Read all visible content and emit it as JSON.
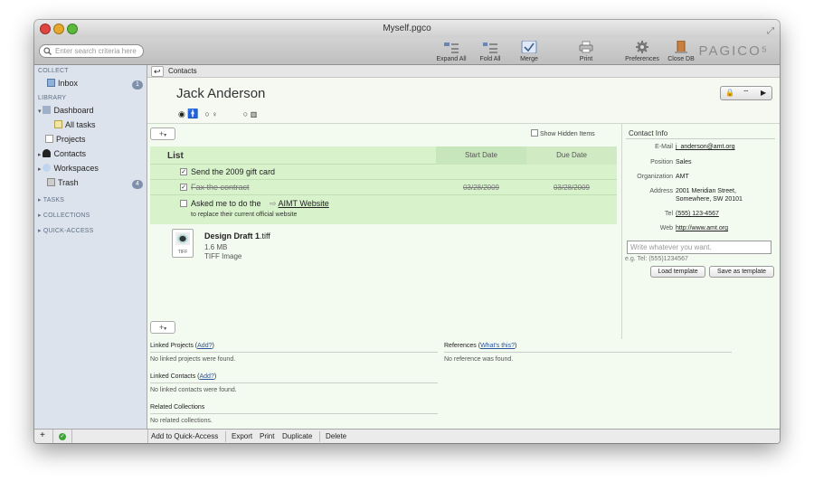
{
  "window": {
    "title": "Myself.pgco"
  },
  "toolbar": {
    "search_placeholder": "Enter search criteria here",
    "expand_all": "Expand All",
    "fold_all": "Fold All",
    "merge": "Merge",
    "print": "Print",
    "preferences": "Preferences",
    "close_db": "Close DB",
    "brand": "PAGICO⁵"
  },
  "sidebar": {
    "collect": "COLLECT",
    "inbox": "Inbox",
    "inbox_count": "1",
    "library": "LIBRARY",
    "dashboard": "Dashboard",
    "all_tasks": "All tasks",
    "projects": "Projects",
    "contacts": "Contacts",
    "workspaces": "Workspaces",
    "trash": "Trash",
    "trash_count": "4",
    "tasks": "TASKS",
    "collections": "COLLECTIONS",
    "quick_access": "QUICK-ACCESS"
  },
  "breadcrumb": {
    "current": "Contacts"
  },
  "contact": {
    "name": "Jack Anderson"
  },
  "list": {
    "show_hidden": "Show Hidden Items",
    "title": "List",
    "col_start": "Start Date",
    "col_due": "Due Date",
    "items": [
      {
        "text": "Send the 2009 gift card",
        "start": "",
        "due": ""
      },
      {
        "text": "Fax the contract",
        "start": "03/28/2009",
        "due": "03/28/2009"
      },
      {
        "text": "Asked me to do the",
        "link": "AIMT Website",
        "note": "to replace their current official website",
        "start": "",
        "due": ""
      }
    ]
  },
  "file": {
    "name": "Design Draft 1",
    "ext": ".tiff",
    "size": "1.6 MB",
    "kind": "TIFF Image",
    "icon_text": "TIFF"
  },
  "info": {
    "title": "Contact Info",
    "email_label": "E-Mail",
    "email": "j_anderson@amt.org",
    "position_label": "Position",
    "position": "Sales",
    "org_label": "Organization",
    "org": "AMT",
    "address_label": "Address",
    "address1": "2001 Meridian Street,",
    "address2": "Somewhere, SW 20101",
    "tel_label": "Tel",
    "tel": "(555) 123-4567",
    "web_label": "Web",
    "web": "http://www.amt.org",
    "field_placeholder": "Write whatever you want.",
    "hint": "e.g. Tel: (555)1234567",
    "load_template": "Load template",
    "save_template": "Save as template"
  },
  "linked": {
    "projects_title": "Linked Projects",
    "projects_add": "Add?",
    "projects_empty": "No linked projects were found.",
    "contacts_title": "Linked Contacts",
    "contacts_add": "Add?",
    "contacts_empty": "No linked contacts were found.",
    "collections_title": "Related Collections",
    "collections_empty": "No related collections.",
    "refs_title": "References",
    "refs_link": "What's this?",
    "refs_empty": "No reference was found."
  },
  "bottombar": {
    "add_quick": "Add to Quick-Access",
    "export": "Export",
    "print": "Print",
    "duplicate": "Duplicate",
    "delete": "Delete"
  }
}
